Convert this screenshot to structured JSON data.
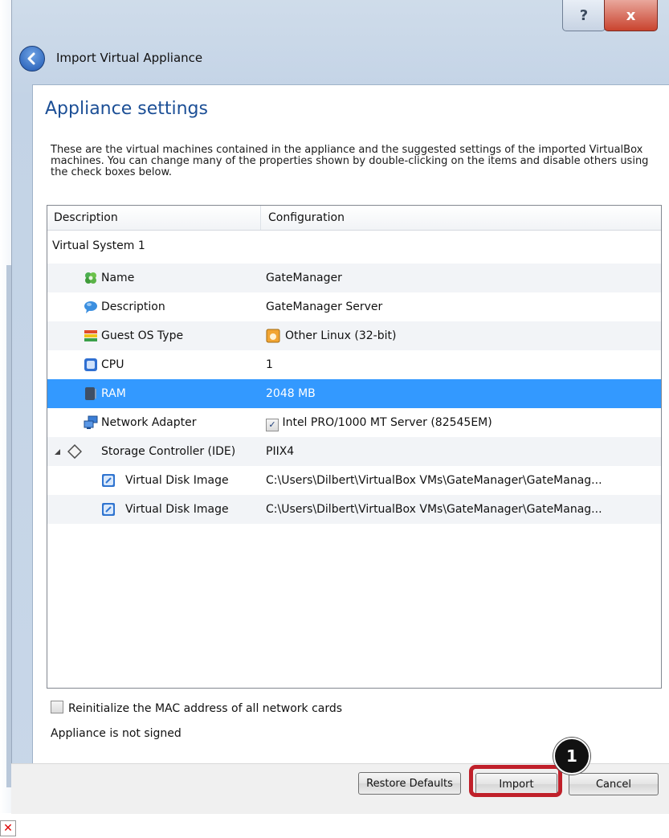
{
  "window": {
    "title": "Import Virtual Appliance",
    "help_label": "?",
    "close_label": "x"
  },
  "page": {
    "heading": "Appliance settings",
    "intro": "These are the virtual machines contained in the appliance and the suggested settings of the imported VirtualBox machines. You can change many of the properties shown by double-clicking on the items and disable others using the check boxes below."
  },
  "table": {
    "headers": [
      "Description",
      "Configuration"
    ],
    "rows": [
      {
        "description": "Virtual System 1",
        "configuration": "",
        "icon": "none"
      },
      {
        "description": "Name",
        "configuration": "GateManager",
        "icon": "name-icon"
      },
      {
        "description": "Description",
        "configuration": "GateManager Server",
        "icon": "description-icon"
      },
      {
        "description": "Guest OS Type",
        "configuration": "Other Linux (32-bit)",
        "icon": "os-type-icon"
      },
      {
        "description": "CPU",
        "configuration": "1",
        "icon": "cpu-icon"
      },
      {
        "description": "RAM",
        "configuration": "2048 MB",
        "icon": "ram-icon",
        "selected": true
      },
      {
        "description": "Network Adapter",
        "configuration": "Intel PRO/1000 MT Server (82545EM)",
        "icon": "network-icon",
        "checked": true
      },
      {
        "description": "Storage Controller (IDE)",
        "configuration": "PIIX4",
        "icon": "storage-icon"
      },
      {
        "description": "Virtual Disk Image",
        "configuration": "C:\\Users\\Dilbert\\VirtualBox VMs\\GateManager\\GateManag...",
        "icon": "disk-icon"
      },
      {
        "description": "Virtual Disk Image",
        "configuration": "C:\\Users\\Dilbert\\VirtualBox VMs\\GateManager\\GateManag...",
        "icon": "disk-icon"
      }
    ]
  },
  "options": {
    "reinit_mac_label": "Reinitialize the MAC address of all network cards",
    "signed_status": "Appliance is not signed"
  },
  "buttons": {
    "restore_defaults": "Restore Defaults",
    "import": "Import",
    "cancel": "Cancel"
  },
  "callout": {
    "number": "1",
    "color": "#c0202a"
  },
  "colors": {
    "selection": "#3399ff",
    "heading": "#1c4f96"
  }
}
